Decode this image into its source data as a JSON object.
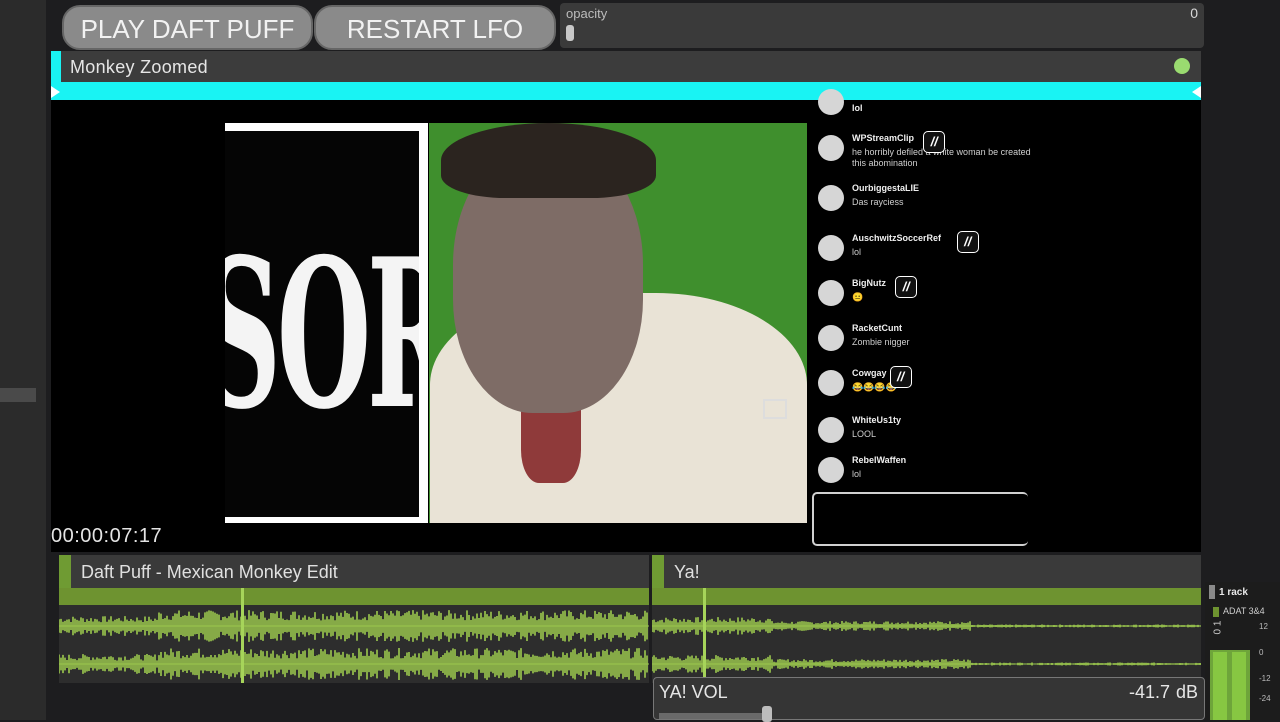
{
  "buttons": {
    "play": "PLAY DAFT PUFF",
    "restart": "RESTART LFO"
  },
  "opacity": {
    "label": "opacity",
    "value": "0"
  },
  "clip": {
    "title": "Monkey Zoomed",
    "timecode": "00:00:07:17",
    "sign_text": "SORED"
  },
  "chat": [
    {
      "name": "lol",
      "text": ""
    },
    {
      "name": "WPStreamClip",
      "text": "he horribly defiled a white woman be created this abomination",
      "badge": "//"
    },
    {
      "name": "OurbiggestaLIE",
      "text": "Das rayciess"
    },
    {
      "name": "AuschwitzSoccerRef",
      "text": "lol",
      "badge": "//"
    },
    {
      "name": "BigNutz",
      "text": "😐",
      "badge": "//"
    },
    {
      "name": "RacketCunt",
      "text": "Zombie nigger"
    },
    {
      "name": "Cowgay",
      "text": "😂😂😂😂",
      "badge": "//"
    },
    {
      "name": "WhiteUs1ty",
      "text": "LOOL"
    },
    {
      "name": "RebelWaffen",
      "text": "lol"
    }
  ],
  "tracks": [
    {
      "title": "Daft Puff - Mexican Monkey Edit"
    },
    {
      "title": "Ya!"
    }
  ],
  "volume": {
    "label": "YA! VOL",
    "value": "-41.7",
    "unit": "dB"
  },
  "meter": {
    "rack": "1 rack",
    "device": "ADAT 3&4",
    "channels": "0 1",
    "ticks": [
      "12",
      "0",
      "-12",
      "-24"
    ]
  },
  "colors": {
    "accent_cyan": "#19f3f3",
    "track_green": "#6e9330",
    "wave_green": "#9cc94e"
  }
}
